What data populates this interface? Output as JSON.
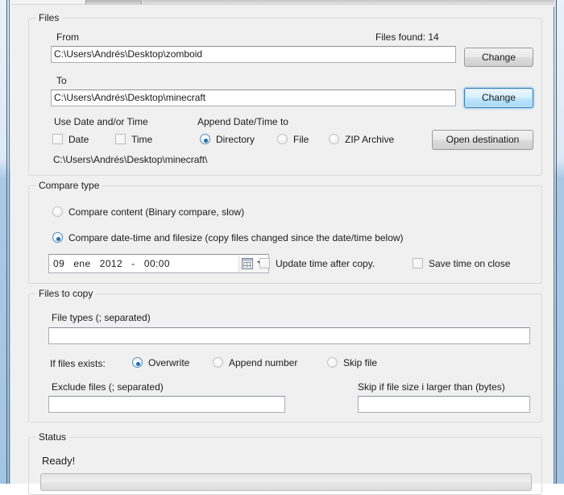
{
  "window": {
    "accent_border": "#a8c8e6",
    "client_bg": "#f0f0f0"
  },
  "tabs": [
    {
      "label": "",
      "active": true
    }
  ],
  "files_group": {
    "title": "Files",
    "from_label": "From",
    "from_value": "C:\\Users\\Andrés\\Desktop\\zomboid",
    "from_change_label": "Change",
    "to_label": "To",
    "to_value": "C:\\Users\\Andrés\\Desktop\\minecraft",
    "to_change_label": "Change",
    "files_found_label": "Files found: 14",
    "use_datetime_label": "Use Date and/or Time",
    "date_checkbox_label": "Date",
    "date_checked": false,
    "time_checkbox_label": "Time",
    "time_checked": false,
    "append_label": "Append Date/Time to",
    "append_options": [
      {
        "label": "Directory",
        "selected": true
      },
      {
        "label": "File",
        "selected": false
      },
      {
        "label": "ZIP Archive",
        "selected": false
      }
    ],
    "open_destination_label": "Open destination",
    "resolved_path": "C:\\Users\\Andrés\\Desktop\\minecraft\\"
  },
  "compare_group": {
    "title": "Compare type",
    "options": [
      {
        "label": "Compare content (Binary compare, slow)",
        "selected": false
      },
      {
        "label": "Compare date-time and filesize (copy files changed since the date/time below)",
        "selected": true
      }
    ],
    "datetime_value": "09   ene   2012   -   00:00",
    "datetime_icon": "calendar-dropdown-icon",
    "update_time_label": "Update time after copy.",
    "update_time_checked": false,
    "save_time_label": "Save time on close",
    "save_time_checked": false
  },
  "files_to_copy_group": {
    "title": "Files to copy",
    "file_types_label": "File types (; separated)",
    "file_types_value": "",
    "file_types_placeholder": "",
    "if_exists_label": "If files exists:",
    "if_exists_options": [
      {
        "label": "Overwrite",
        "selected": true
      },
      {
        "label": "Append number",
        "selected": false
      },
      {
        "label": "Skip file",
        "selected": false
      }
    ],
    "exclude_label": "Exclude files (; separated)",
    "exclude_value": "",
    "exclude_placeholder": "",
    "skip_size_label": "Skip if file size i larger than (bytes)",
    "skip_size_value": "",
    "skip_size_placeholder": ""
  },
  "status_group": {
    "title": "Status",
    "status_text": "Ready!",
    "progress_percent": 0
  }
}
